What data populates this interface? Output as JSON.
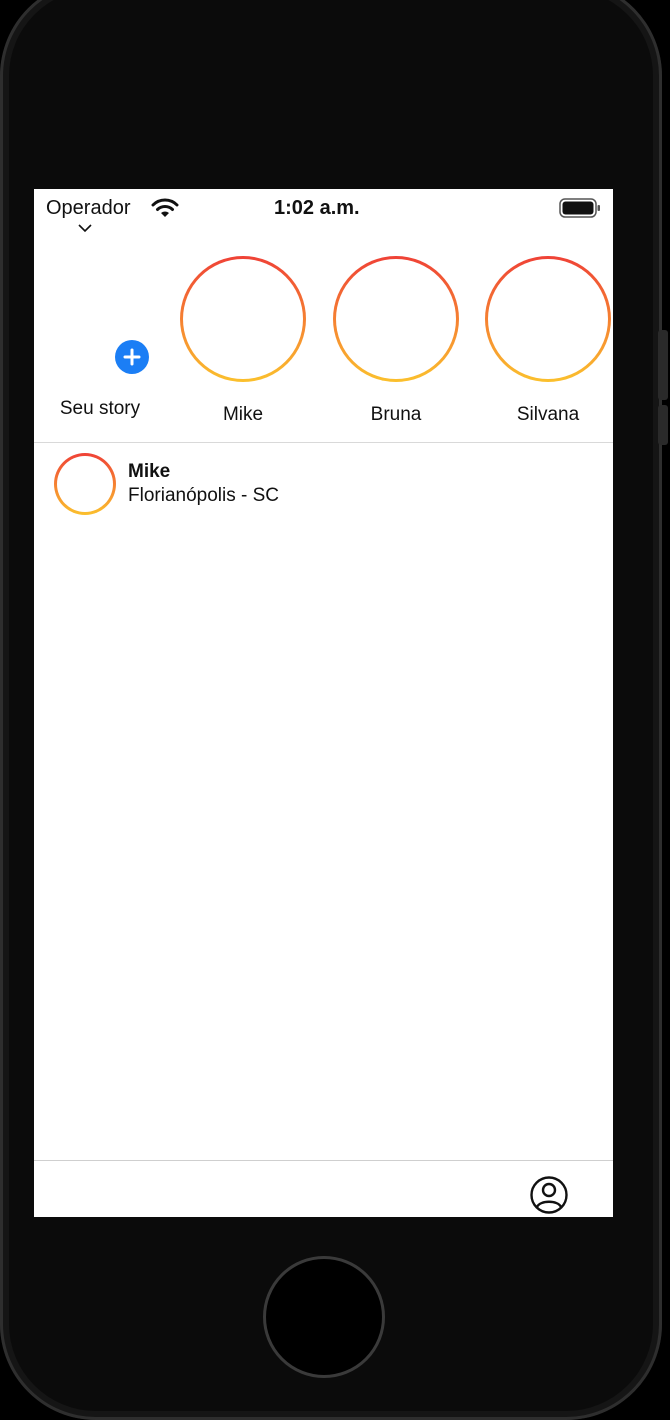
{
  "status_bar": {
    "carrier": "Operador",
    "time": "1:02 a.m."
  },
  "stories": [
    {
      "label": "Seu story"
    },
    {
      "label": "Mike"
    },
    {
      "label": "Bruna"
    },
    {
      "label": "Silvana"
    }
  ],
  "feed": {
    "posts": [
      {
        "name": "Mike",
        "location": "Florianópolis - SC"
      }
    ]
  },
  "tab_bar": {
    "icon": "person-circle-icon"
  },
  "colors": {
    "ring_top": "#ef4136",
    "ring_bottom": "#fbc02d",
    "add_badge": "#1b7ef5"
  }
}
